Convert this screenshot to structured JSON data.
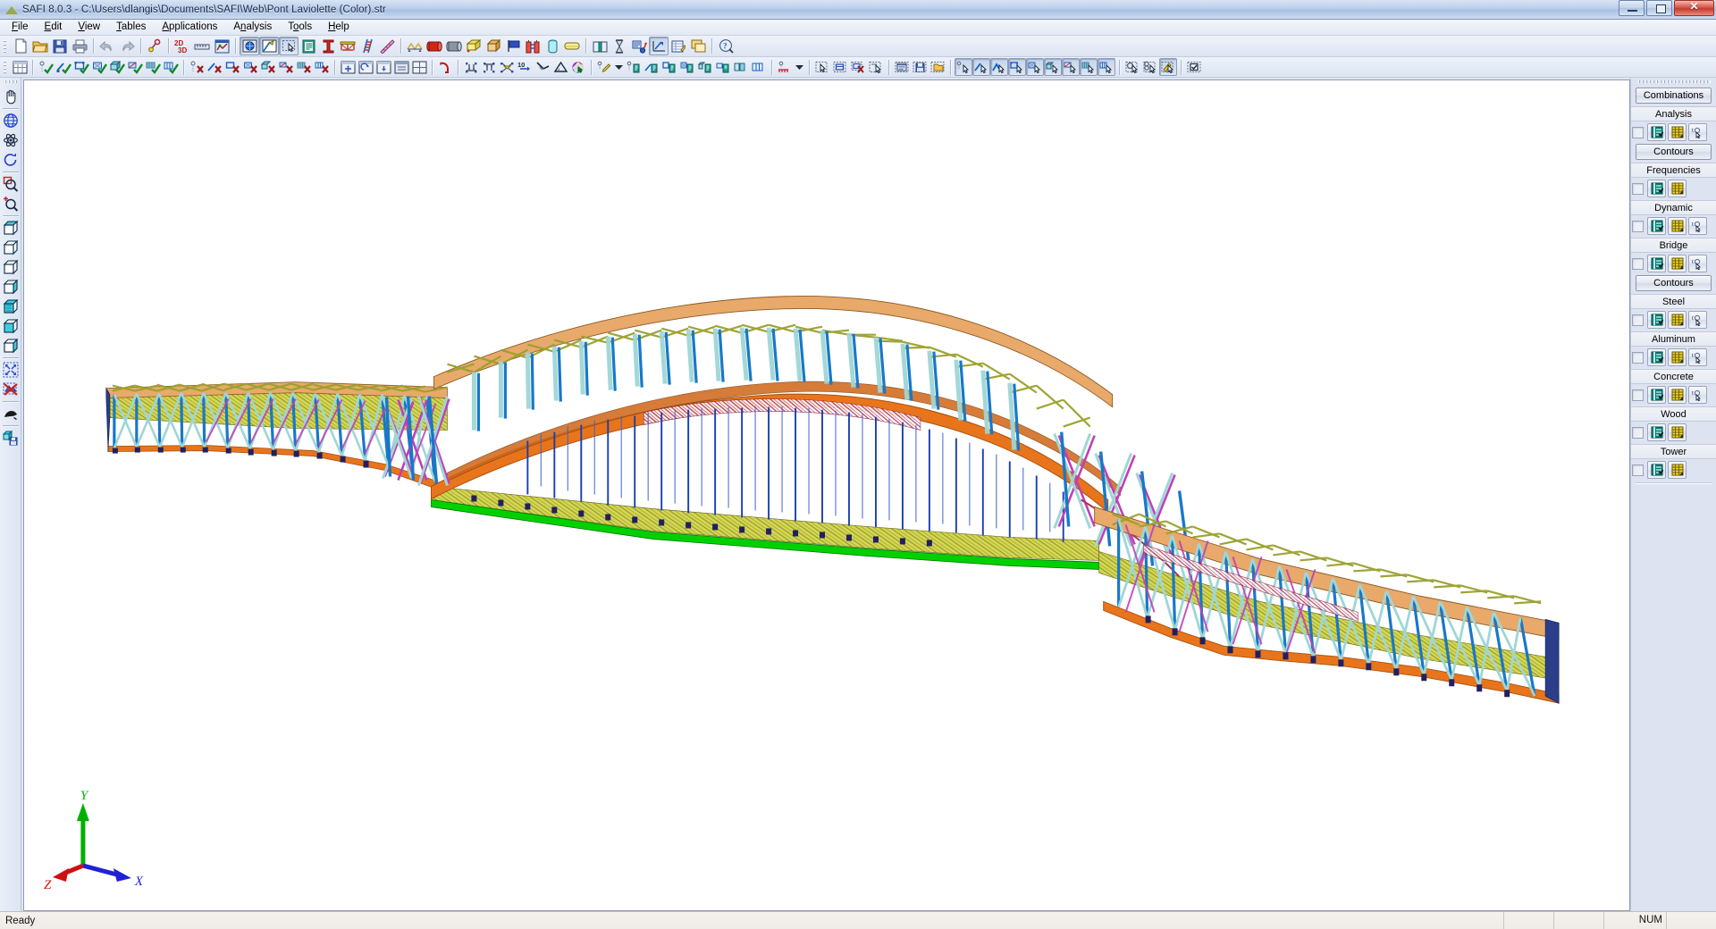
{
  "window": {
    "title": "SAFI 8.0.3 - C:\\Users\\dlangis\\Documents\\SAFI\\Web\\Pont Laviolette (Color).str",
    "app_icon": "safi-triangle-icon",
    "controls": {
      "minimize": "minimize-button",
      "restore": "restore-button",
      "close": "close-button"
    }
  },
  "menubar": {
    "items": [
      {
        "label": "File"
      },
      {
        "label": "Edit"
      },
      {
        "label": "View"
      },
      {
        "label": "Tables"
      },
      {
        "label": "Applications"
      },
      {
        "label": "Analysis"
      },
      {
        "label": "Tools"
      },
      {
        "label": "Help"
      }
    ]
  },
  "toolbar_main": {
    "groups": [
      {
        "buttons": [
          {
            "name": "new-file-icon"
          },
          {
            "name": "open-folder-icon"
          },
          {
            "name": "save-disk-icon"
          },
          {
            "name": "print-icon"
          }
        ]
      },
      {
        "buttons": [
          {
            "name": "undo-arrow-icon"
          },
          {
            "name": "redo-arrow-icon"
          }
        ]
      },
      {
        "buttons": [
          {
            "name": "node-probe-icon"
          }
        ]
      },
      {
        "buttons": [
          {
            "name": "2d-3d-toggle-icon",
            "label_top": "2D",
            "label_bottom": "3D"
          },
          {
            "name": "ruler-icon"
          },
          {
            "name": "chart-graph-icon"
          }
        ]
      },
      {
        "buttons": [
          {
            "name": "render-view-icon",
            "pressed": true
          },
          {
            "name": "draw-model-icon",
            "pressed": true
          },
          {
            "name": "selection-box-icon",
            "pressed": true
          },
          {
            "name": "report-document-icon"
          },
          {
            "name": "section-profile-icon"
          },
          {
            "name": "bridge-deck-icon"
          },
          {
            "name": "stair-ladder-icon"
          },
          {
            "name": "measure-diagonal-icon"
          }
        ]
      },
      {
        "buttons": [
          {
            "name": "truss-supports-icon"
          },
          {
            "name": "red-beam-icon"
          },
          {
            "name": "gray-beam-icon"
          },
          {
            "name": "yellow-slab-icon"
          },
          {
            "name": "solid-block-icon"
          },
          {
            "name": "blue-flag-icon"
          },
          {
            "name": "building-frame-icon"
          },
          {
            "name": "cylinder-tank-icon"
          },
          {
            "name": "plate-surface-icon"
          }
        ]
      },
      {
        "buttons": [
          {
            "name": "book-open-icon"
          },
          {
            "name": "hourglass-icon"
          },
          {
            "name": "analysis-run-icon"
          },
          {
            "name": "axis-transform-icon",
            "pressed": true
          },
          {
            "name": "edit-table-icon"
          },
          {
            "name": "window-cascade-icon"
          }
        ]
      },
      {
        "buttons": [
          {
            "name": "help-search-icon"
          }
        ]
      }
    ]
  },
  "toolbar_view": {
    "groups": [
      {
        "buttons": [
          {
            "name": "grid-window-icon"
          }
        ]
      },
      {
        "buttons": [
          {
            "name": "show-nodes-icon"
          },
          {
            "name": "show-members-icon"
          },
          {
            "name": "show-plates-icon"
          },
          {
            "name": "show-shells-icon"
          },
          {
            "name": "show-solids-icon"
          },
          {
            "name": "show-supports-icon"
          },
          {
            "name": "show-mesh-icon"
          },
          {
            "name": "show-panels-icon"
          }
        ]
      },
      {
        "buttons": [
          {
            "name": "hide-nodes-icon"
          },
          {
            "name": "hide-members-icon"
          },
          {
            "name": "hide-plates-icon"
          },
          {
            "name": "hide-shells-icon"
          },
          {
            "name": "hide-solids-icon"
          },
          {
            "name": "hide-supports-icon"
          },
          {
            "name": "hide-mesh-icon"
          },
          {
            "name": "hide-panels-icon"
          }
        ]
      },
      {
        "buttons": [
          {
            "name": "pan-window-icon"
          },
          {
            "name": "fit-window-icon"
          },
          {
            "name": "rotate-window-icon"
          },
          {
            "name": "zoom-window-icon"
          },
          {
            "name": "layout-window-icon"
          }
        ]
      },
      {
        "buttons": [
          {
            "name": "local-axes-icon"
          }
        ]
      },
      {
        "buttons": [
          {
            "name": "align-down-icon"
          },
          {
            "name": "align-up-icon"
          },
          {
            "name": "diagonal-cross-icon"
          },
          {
            "name": "numbering-icon"
          },
          {
            "name": "angle-measure-icon"
          },
          {
            "name": "triangle-measure-icon"
          },
          {
            "name": "color-palette-icon"
          }
        ]
      },
      {
        "buttons": [
          {
            "name": "annotate-pencil-icon"
          },
          {
            "name": "annotate-dropdown-icon",
            "is_dropdown": true
          },
          {
            "name": "label-nodes-icon"
          },
          {
            "name": "label-members-icon"
          },
          {
            "name": "label-plates-icon"
          },
          {
            "name": "label-shells-icon"
          },
          {
            "name": "label-solids-icon"
          },
          {
            "name": "label-supports-icon"
          },
          {
            "name": "label-groups-icon"
          },
          {
            "name": "label-panels-icon"
          }
        ]
      },
      {
        "buttons": [
          {
            "name": "load-grid-icon"
          },
          {
            "name": "load-dropdown-icon",
            "is_dropdown": true
          }
        ]
      },
      {
        "buttons": [
          {
            "name": "select-pointer-icon"
          },
          {
            "name": "select-window-icon"
          },
          {
            "name": "deselect-icon"
          },
          {
            "name": "select-single-icon"
          }
        ]
      },
      {
        "buttons": [
          {
            "name": "list-document-icon"
          },
          {
            "name": "save-selection-icon"
          },
          {
            "name": "open-selection-icon"
          }
        ]
      },
      {
        "buttons": [
          {
            "name": "pick-node-icon",
            "pressed": true
          },
          {
            "name": "pick-member-icon",
            "pressed": true
          },
          {
            "name": "pick-chain-icon",
            "pressed": true
          },
          {
            "name": "pick-plate-icon",
            "pressed": true
          },
          {
            "name": "pick-shell-icon",
            "pressed": true
          },
          {
            "name": "pick-solid-icon",
            "pressed": true
          },
          {
            "name": "pick-support-icon",
            "pressed": true
          },
          {
            "name": "pick-mesh-icon",
            "pressed": true
          },
          {
            "name": "pick-panel-icon",
            "pressed": true
          }
        ]
      },
      {
        "buttons": [
          {
            "name": "zoom-select-icon"
          },
          {
            "name": "zoom-node-icon"
          },
          {
            "name": "highlight-select-icon",
            "pressed": true
          }
        ]
      },
      {
        "buttons": [
          {
            "name": "checkbox-select-icon"
          }
        ]
      }
    ]
  },
  "vertical_toolbar": {
    "groups": [
      {
        "buttons": [
          {
            "name": "pan-hand-icon"
          }
        ]
      },
      {
        "buttons": [
          {
            "name": "globe-rotate-icon"
          },
          {
            "name": "orbit-atom-icon"
          },
          {
            "name": "rotate-circle-icon"
          }
        ]
      },
      {
        "buttons": [
          {
            "name": "zoom-window-red-icon"
          },
          {
            "name": "zoom-extents-icon"
          }
        ]
      },
      {
        "buttons": [
          {
            "name": "view-iso-icon"
          },
          {
            "name": "view-wireframe-icon"
          },
          {
            "name": "view-front-icon"
          },
          {
            "name": "view-left-icon"
          },
          {
            "name": "view-top-icon"
          },
          {
            "name": "view-right-icon"
          },
          {
            "name": "view-back-icon"
          }
        ]
      },
      {
        "buttons": [
          {
            "name": "fit-selection-icon"
          },
          {
            "name": "clear-view-icon"
          }
        ]
      },
      {
        "buttons": [
          {
            "name": "render-shade-icon"
          }
        ]
      },
      {
        "buttons": [
          {
            "name": "save-view-icon"
          }
        ]
      }
    ]
  },
  "right_panel": {
    "combinations_button": "Combinations",
    "contours_button_1": "Contours",
    "contours_button_2": "Contours",
    "sections": [
      {
        "label": "Analysis",
        "icons": [
          "results-list-icon",
          "results-table-icon",
          "results-pick-icon"
        ]
      },
      {
        "label": "Frequencies",
        "icons": [
          "results-list-icon",
          "results-table-icon"
        ]
      },
      {
        "label": "Dynamic",
        "icons": [
          "results-list-icon",
          "results-table-icon",
          "results-pick-icon"
        ]
      },
      {
        "label": "Bridge",
        "icons": [
          "results-list-icon",
          "results-table-icon",
          "results-pick-icon"
        ]
      },
      {
        "label": "Steel",
        "icons": [
          "results-list-icon",
          "results-table-icon",
          "results-pick-icon"
        ]
      },
      {
        "label": "Aluminum",
        "icons": [
          "results-list-icon",
          "results-table-icon",
          "results-pick-icon"
        ]
      },
      {
        "label": "Concrete",
        "icons": [
          "results-list-icon",
          "results-table-icon",
          "results-pick-icon"
        ]
      },
      {
        "label": "Wood",
        "icons": [
          "results-list-icon",
          "results-table-icon"
        ]
      },
      {
        "label": "Tower",
        "icons": [
          "results-list-icon",
          "results-table-icon"
        ]
      }
    ]
  },
  "canvas": {
    "model_name": "Pont Laviolette bridge model",
    "axis_triad": {
      "x_label": "X",
      "y_label": "Y",
      "z_label": "Z",
      "x_color": "#2020d8",
      "y_color": "#00b000",
      "z_color": "#d01010"
    },
    "colors": {
      "arch_rib": "#e8751c",
      "deck_plate": "#cfd24a",
      "top_chord": "#e8a96a",
      "bottom_chord": "#00d000",
      "hanger": "#1a3fb0",
      "diagonal_light": "#9fd6d6",
      "diagonal_magenta": "#c040b8",
      "vertical_post": "#1878c8",
      "truss_red": "#b03050",
      "background": "#ffffff"
    }
  },
  "statusbar": {
    "message": "Ready",
    "indicators": [
      "",
      "",
      "NUM",
      ""
    ]
  }
}
